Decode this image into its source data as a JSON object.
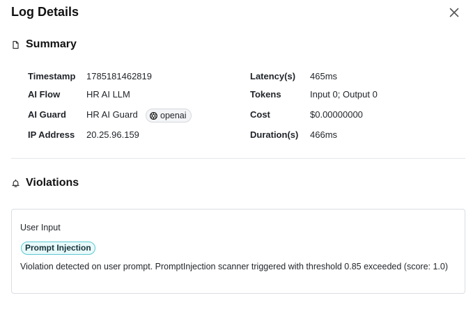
{
  "dialog": {
    "title": "Log Details"
  },
  "summary": {
    "heading": "Summary",
    "left": [
      {
        "label": "Timestamp",
        "value": "1785181462819"
      },
      {
        "label": "AI Flow",
        "value": "HR AI LLM"
      },
      {
        "label": "AI Guard",
        "value": "HR AI Guard",
        "badge": "openai"
      },
      {
        "label": "IP Address",
        "value": "20.25.96.159"
      }
    ],
    "right": [
      {
        "label": "Latency(s)",
        "value": "465ms"
      },
      {
        "label": "Tokens",
        "value": "Input 0; Output 0"
      },
      {
        "label": "Cost",
        "value": "$0.00000000"
      },
      {
        "label": "Duration(s)",
        "value": "466ms"
      }
    ]
  },
  "violations": {
    "heading": "Violations",
    "card": {
      "title": "User Input",
      "tag": "Prompt Injection",
      "description": "Violation detected on user prompt. PromptInjection scanner triggered with threshold 0.85 exceeded (score: 1.0)"
    }
  },
  "icons": {
    "close": "close-icon",
    "summary": "document-icon",
    "violations": "bell-icon",
    "provider": "openai-logo-icon"
  },
  "colors": {
    "tag_border": "#5bc8d0",
    "tag_bg": "#e9fafb"
  }
}
